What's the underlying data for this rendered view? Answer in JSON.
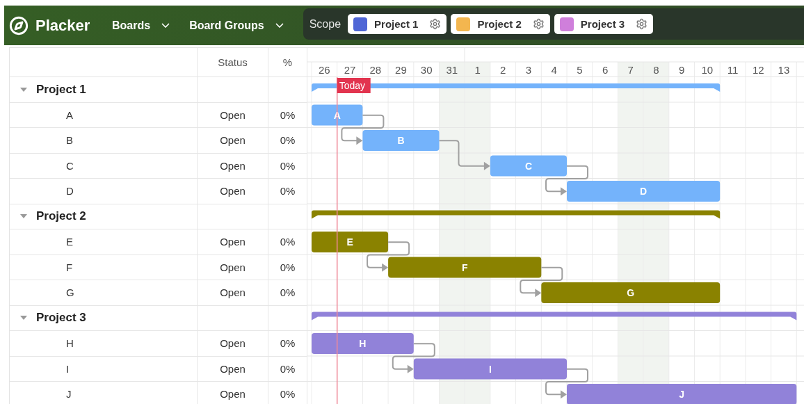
{
  "app": {
    "name": "Placker"
  },
  "nav": [
    {
      "label": "Boards"
    },
    {
      "label": "Board Groups"
    }
  ],
  "scope": {
    "label": "Scope",
    "projects": [
      {
        "name": "Project 1",
        "color": "#4f66d6"
      },
      {
        "name": "Project 2",
        "color": "#f3b64f"
      },
      {
        "name": "Project 3",
        "color": "#cf7fdb"
      }
    ]
  },
  "table": {
    "columns": [
      "Status",
      "%"
    ],
    "days": [
      {
        "label": "26",
        "weekend": false,
        "today": false
      },
      {
        "label": "27",
        "weekend": false,
        "today": true
      },
      {
        "label": "28",
        "weekend": false,
        "today": false
      },
      {
        "label": "29",
        "weekend": false,
        "today": false
      },
      {
        "label": "30",
        "weekend": false,
        "today": false
      },
      {
        "label": "31",
        "weekend": true,
        "today": false
      },
      {
        "label": "1",
        "weekend": true,
        "today": false
      },
      {
        "label": "2",
        "weekend": false,
        "today": false
      },
      {
        "label": "3",
        "weekend": false,
        "today": false
      },
      {
        "label": "4",
        "weekend": false,
        "today": false
      },
      {
        "label": "5",
        "weekend": false,
        "today": false
      },
      {
        "label": "6",
        "weekend": false,
        "today": false
      },
      {
        "label": "7",
        "weekend": true,
        "today": false
      },
      {
        "label": "8",
        "weekend": true,
        "today": false
      },
      {
        "label": "9",
        "weekend": false,
        "today": false
      },
      {
        "label": "10",
        "weekend": false,
        "today": false
      },
      {
        "label": "11",
        "weekend": false,
        "today": false
      },
      {
        "label": "12",
        "weekend": false,
        "today": false
      },
      {
        "label": "13",
        "weekend": false,
        "today": false
      }
    ],
    "today_label": "Today",
    "groups": [
      {
        "name": "Project 1",
        "expanded": true,
        "color": "#74b3fb",
        "tasks": [
          {
            "name": "A",
            "status": "Open",
            "percent": "0%",
            "bar_label": "A"
          },
          {
            "name": "B",
            "status": "Open",
            "percent": "0%",
            "bar_label": "B"
          },
          {
            "name": "C",
            "status": "Open",
            "percent": "0%",
            "bar_label": "C"
          },
          {
            "name": "D",
            "status": "Open",
            "percent": "0%",
            "bar_label": "D"
          }
        ]
      },
      {
        "name": "Project 2",
        "expanded": true,
        "color": "#8a8200",
        "tasks": [
          {
            "name": "E",
            "status": "Open",
            "percent": "0%",
            "bar_label": "E"
          },
          {
            "name": "F",
            "status": "Open",
            "percent": "0%",
            "bar_label": "F"
          },
          {
            "name": "G",
            "status": "Open",
            "percent": "0%",
            "bar_label": "G"
          }
        ]
      },
      {
        "name": "Project 3",
        "expanded": true,
        "color": "#9182d9",
        "tasks": [
          {
            "name": "H",
            "status": "Open",
            "percent": "0%",
            "bar_label": "H"
          },
          {
            "name": "I",
            "status": "Open",
            "percent": "0%",
            "bar_label": "I"
          },
          {
            "name": "J",
            "status": "Open",
            "percent": "0%",
            "bar_label": "J"
          }
        ]
      }
    ]
  }
}
